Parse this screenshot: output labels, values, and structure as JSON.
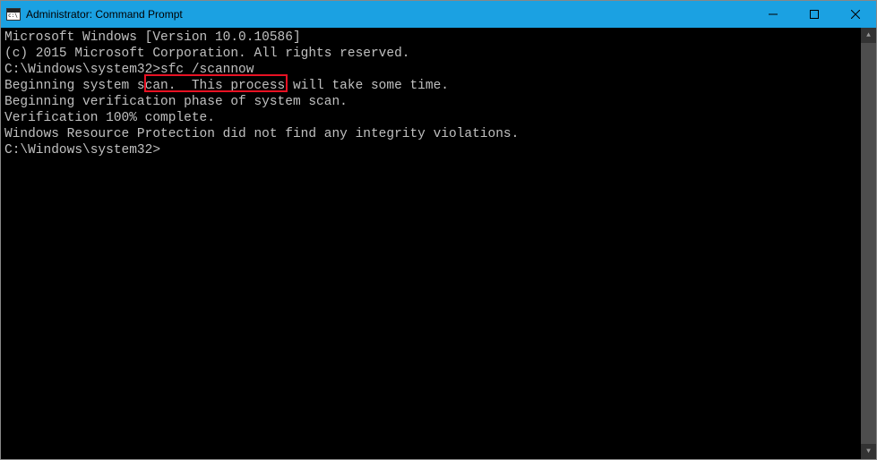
{
  "window": {
    "title": "Administrator: Command Prompt"
  },
  "terminal": {
    "line1": "Microsoft Windows [Version 10.0.10586]",
    "line2": "(c) 2015 Microsoft Corporation. All rights reserved.",
    "blank1": "",
    "prompt1_path": "C:\\Windows\\system32>",
    "prompt1_cmd": "sfc /scannow",
    "blank2": "",
    "line3": "Beginning system scan.  This process will take some time.",
    "blank3": "",
    "line4": "Beginning verification phase of system scan.",
    "line5": "Verification 100% complete.",
    "blank4": "",
    "line6": "Windows Resource Protection did not find any integrity violations.",
    "blank5": "",
    "prompt2_path": "C:\\Windows\\system32>",
    "prompt2_cmd": ""
  },
  "annotation": {
    "highlighted_command": "sfc /scannow"
  }
}
